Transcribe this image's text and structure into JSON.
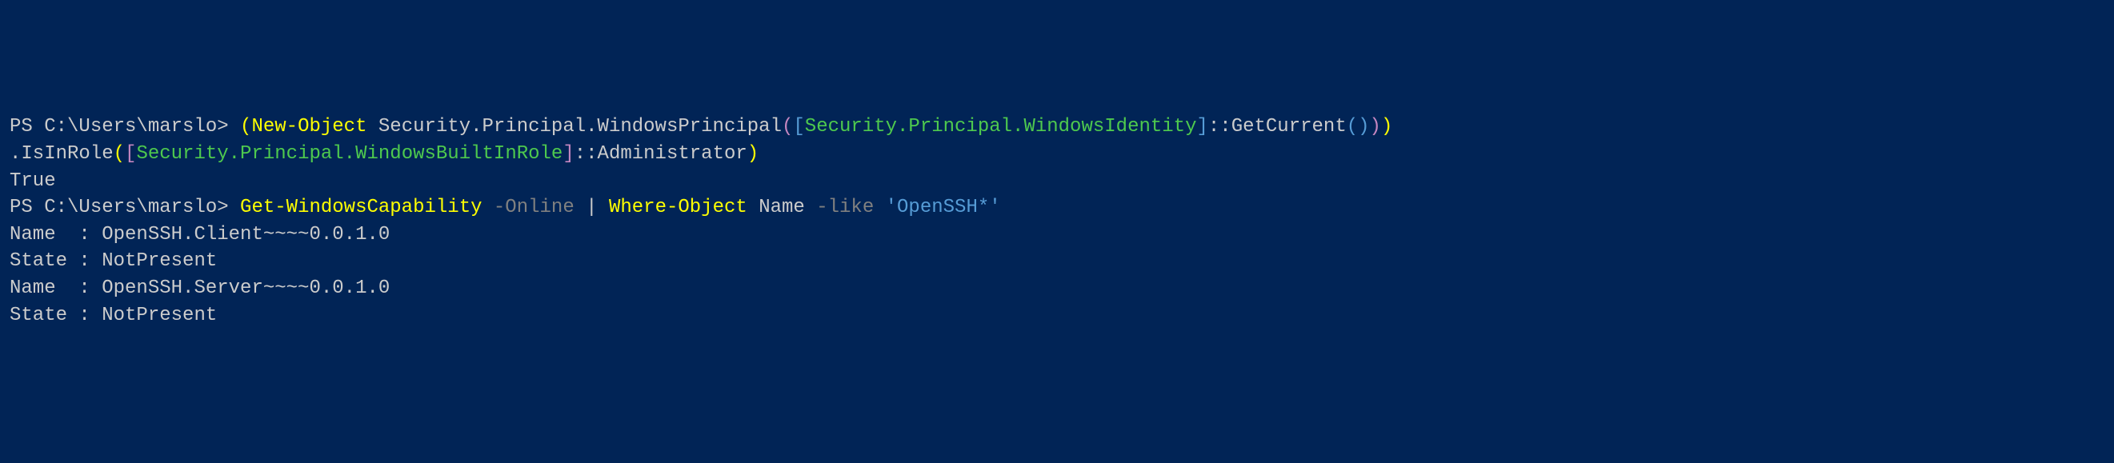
{
  "line1": {
    "prompt": "PS C:\\Users\\marslo> ",
    "open_paren1": "(",
    "new_object": "New-Object",
    "space1": " ",
    "type1": "Security.Principal.WindowsPrincipal",
    "open_paren2": "(",
    "open_bracket": "[",
    "type2": "Security.Principal.WindowsIdentity",
    "close_bracket": "]",
    "method1": "::GetCurrent",
    "open_paren3": "(",
    "close_paren3": ")",
    "close_paren2": ")",
    "close_paren1": ")"
  },
  "line2": {
    "method2": ".IsInRole",
    "open_paren4": "(",
    "open_bracket2": "[",
    "type3": "Security.Principal.WindowsBuiltInRole",
    "close_bracket2": "]",
    "method3": "::Administrator",
    "close_paren4": ")"
  },
  "line3": {
    "output": "True"
  },
  "line4": {
    "prompt": "PS C:\\Users\\marslo> ",
    "cmdlet": "Get-WindowsCapability",
    "space1": " ",
    "param1": "-Online",
    "space2": " ",
    "pipe": "|",
    "space3": " ",
    "cmdlet2": "Where-Object",
    "space4": " ",
    "name": "Name",
    "space5": " ",
    "param2": "-like",
    "space6": " ",
    "string": "'OpenSSH*'"
  },
  "line5": {
    "blank": ""
  },
  "line6": {
    "blank": ""
  },
  "line7": {
    "output": "Name  : OpenSSH.Client~~~~0.0.1.0"
  },
  "line8": {
    "output": "State : NotPresent"
  },
  "line9": {
    "blank": ""
  },
  "line10": {
    "output": "Name  : OpenSSH.Server~~~~0.0.1.0"
  },
  "line11": {
    "output": "State : NotPresent"
  }
}
